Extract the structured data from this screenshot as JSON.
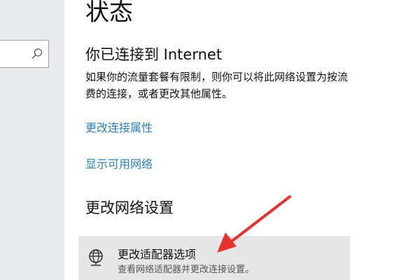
{
  "sidebar": {
    "search": {
      "icon": "search-icon"
    }
  },
  "main": {
    "page_title": "状态",
    "connection": {
      "title": "你已连接到 Internet",
      "description_line1": "如果你的流量套餐有限制，则你可以将此网络设置为按流",
      "description_line2": "费的连接，或者更改其他属性。"
    },
    "links": {
      "change_properties": "更改连接属性",
      "show_available": "显示可用网络"
    },
    "network_settings": {
      "title": "更改网络设置",
      "adapter_option": {
        "icon": "network-adapter-icon",
        "title": "更改适配器选项",
        "subtitle": "查看网络适配器并更改连接设置。"
      }
    }
  },
  "annotation": {
    "icon": "red-arrow",
    "color": "#e8322f"
  },
  "colors": {
    "sidebar_bg": "#e6e9ee",
    "link": "#2b7fb8",
    "highlight_bg": "#e6e6e6"
  }
}
